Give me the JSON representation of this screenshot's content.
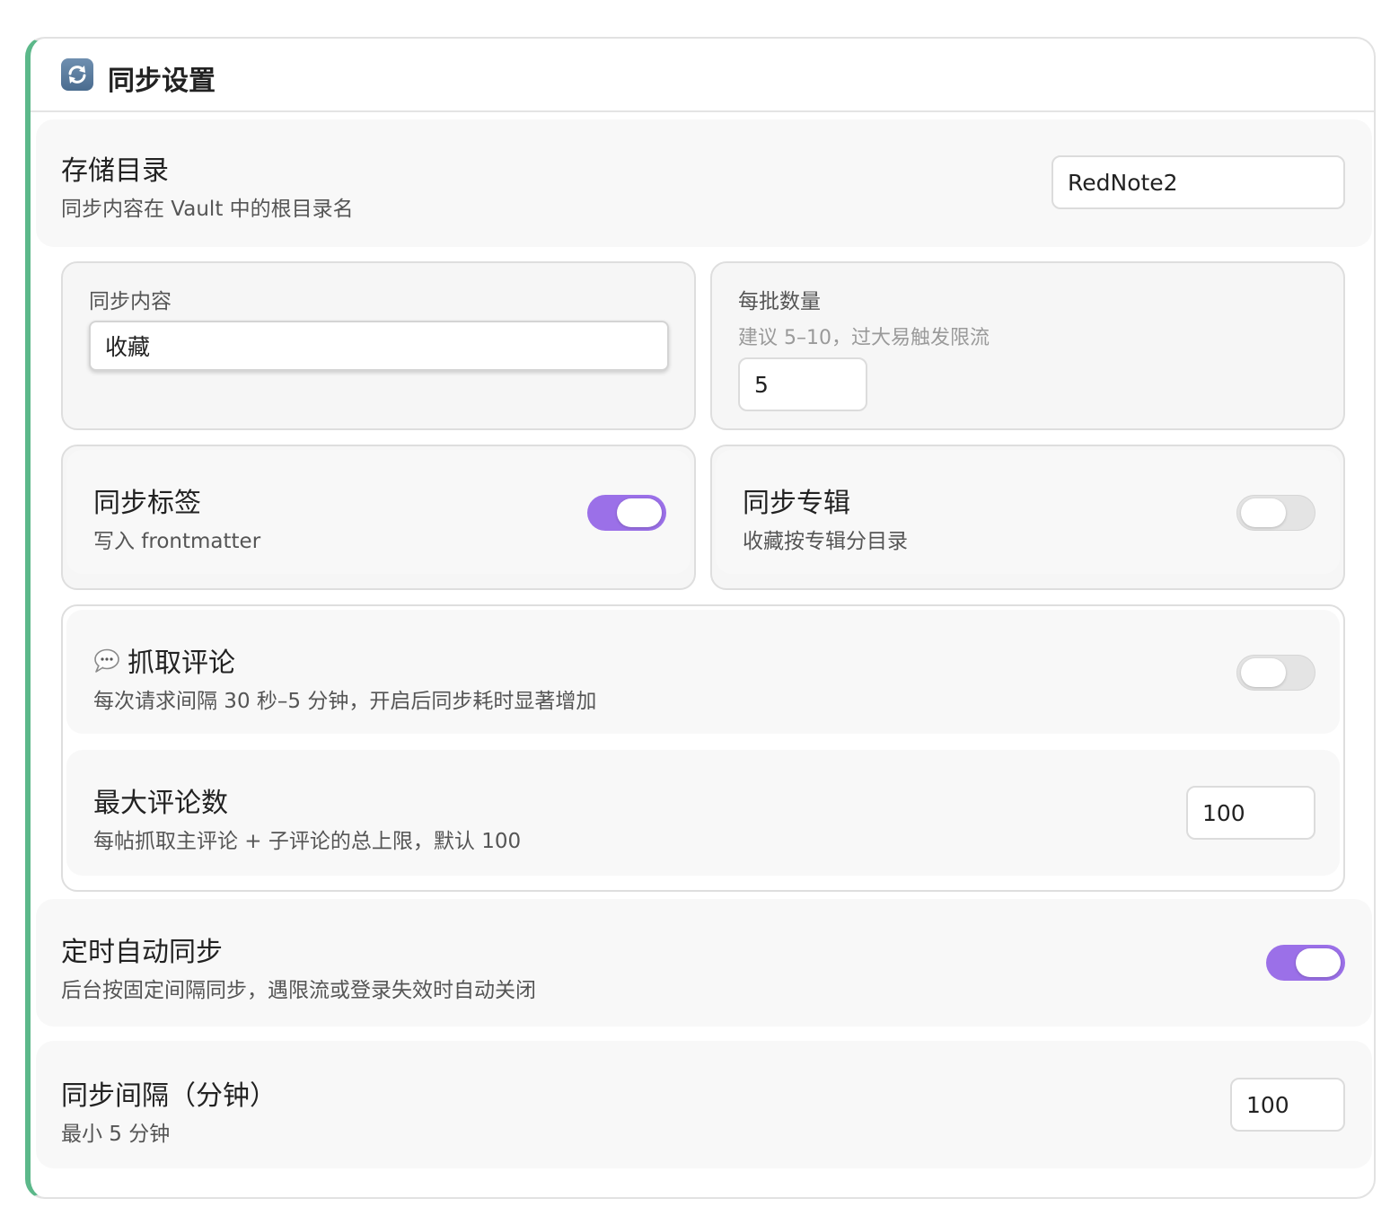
{
  "header": {
    "title": "同步设置",
    "icon": "sync-icon"
  },
  "storage": {
    "title": "存储目录",
    "desc": "同步内容在 Vault 中的根目录名",
    "value": "RedNote2"
  },
  "sync_content": {
    "label": "同步内容",
    "value": "收藏"
  },
  "batch": {
    "label": "每批数量",
    "hint": "建议 5–10，过大易触发限流",
    "value": "5"
  },
  "sync_tags": {
    "title": "同步标签",
    "desc": "写入 frontmatter",
    "enabled": true
  },
  "sync_albums": {
    "title": "同步专辑",
    "desc": "收藏按专辑分目录",
    "enabled": false
  },
  "comments": {
    "title": "抓取评论",
    "icon": "speech-bubble-icon",
    "desc": "每次请求间隔 30 秒–5 分钟，开启后同步耗时显著增加",
    "enabled": false
  },
  "max_comments": {
    "title": "最大评论数",
    "desc": "每帖抓取主评论 + 子评论的总上限，默认 100",
    "value": "100"
  },
  "auto_sync": {
    "title": "定时自动同步",
    "desc": "后台按固定间隔同步，遇限流或登录失效时自动关闭",
    "enabled": true
  },
  "interval": {
    "title": "同步间隔（分钟）",
    "desc": "最小 5 分钟",
    "value": "100"
  },
  "colors": {
    "accent_toggle": "#9b70e8",
    "left_border": "#5cb88a"
  }
}
